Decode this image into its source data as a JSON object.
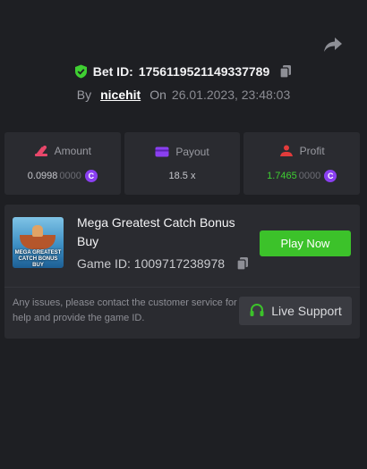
{
  "header": {
    "bet_id_label": "Bet ID:",
    "bet_id": "1756119521149337789",
    "by_label": "By",
    "username": "nicehit",
    "on_label": "On",
    "datetime": "26.01.2023, 23:48:03"
  },
  "stats": {
    "amount": {
      "label": "Amount",
      "value_main": "0.0998",
      "value_dim": "0000"
    },
    "payout": {
      "label": "Payout",
      "value": "18.5 x"
    },
    "profit": {
      "label": "Profit",
      "value_main": "1.7465",
      "value_dim": "0000"
    }
  },
  "game": {
    "title": "Mega Greatest Catch Bonus Buy",
    "thumb_text": "MEGA GREATEST CATCH BONUS BUY",
    "id_label": "Game ID:",
    "id": "1009717238978",
    "play_label": "Play Now"
  },
  "support": {
    "text": "Any issues, please contact the customer service for help and provide the game ID.",
    "button_label": "Live Support"
  },
  "icons": {
    "share": "share-icon",
    "shield": "shield-check-icon",
    "copy": "copy-icon",
    "amount": "amount-icon",
    "payout": "wallet-icon",
    "profit": "profit-icon",
    "coin": "coin-icon",
    "headset": "headset-icon"
  },
  "colors": {
    "background": "#1e1f23",
    "panel": "#2a2b30",
    "accent_green": "#3cc22a",
    "profit_green": "#3fcf32",
    "coin_purple": "#8a3ff0",
    "amount_pink": "#e8476a",
    "payout_purple": "#8a3ff0",
    "profit_red": "#e23b3b"
  }
}
